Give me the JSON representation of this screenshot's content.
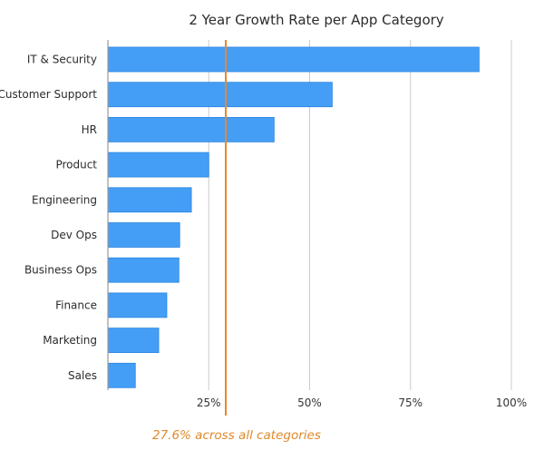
{
  "chart_data": {
    "type": "bar",
    "orientation": "horizontal",
    "title": "2 Year Growth Rate per App Category",
    "xlabel": "",
    "ylabel": "",
    "categories": [
      "IT & Security",
      "Customer Support",
      "HR",
      "Product",
      "Engineering",
      "Dev Ops",
      "Business Ops",
      "Finance",
      "Marketing",
      "Sales"
    ],
    "values": [
      92,
      55.6,
      41.2,
      25,
      20.7,
      17.8,
      17.6,
      14.6,
      12.6,
      6.8
    ],
    "value_unit": "%",
    "xlim": [
      0,
      100
    ],
    "x_ticks": [
      25,
      50,
      75,
      100
    ],
    "x_tick_labels": [
      "25%",
      "50%",
      "75%",
      "100%"
    ],
    "grid": "vertical",
    "legend": "none",
    "reference_line": {
      "value": 27.6,
      "label": "27.6% across all categories",
      "color": "#e8892a"
    },
    "bar_color": "#459ef5",
    "bar_edge_color": "#2a85e0",
    "grid_color": "#cccccc"
  }
}
